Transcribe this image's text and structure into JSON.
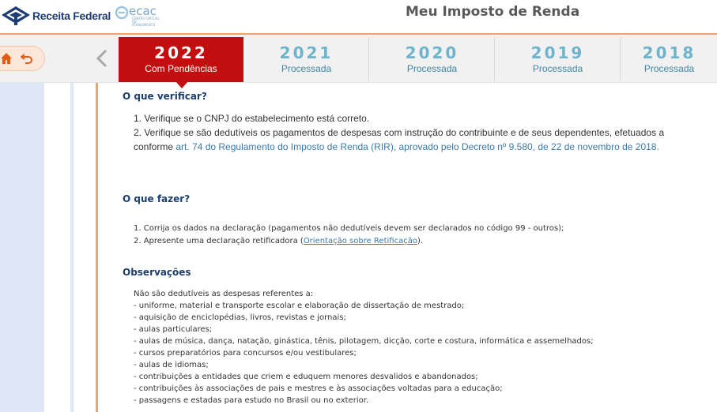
{
  "header": {
    "brand_name": "Receita Federal",
    "ecac_logo_text": "ecac",
    "ecac_subtitle": "CENTRO VIRTUAL DE ATENDIMENTO",
    "app_title": "Meu Imposto de Renda"
  },
  "nav": {
    "home_icon": "home-icon",
    "back_icon": "undo-arrow-icon",
    "prev_icon": "chevron-left-icon"
  },
  "tabs": [
    {
      "year": "2022",
      "status": "Com Pendências",
      "active": true
    },
    {
      "year": "2021",
      "status": "Processada",
      "active": false
    },
    {
      "year": "2020",
      "status": "Processada",
      "active": false
    },
    {
      "year": "2019",
      "status": "Processada",
      "active": false
    },
    {
      "year": "2018",
      "status": "Processada",
      "active": false
    }
  ],
  "verificar": {
    "title": "O que verificar?",
    "item1": "1. Verifique se o CNPJ do estabelecimento está correto.",
    "item2": "2. Verifique se são dedutíveis os pagamentos de despesas com instrução do contribuinte e de seus dependentes, efetuados a",
    "item2_cont_prefix": "conforme ",
    "item2_link": "art. 74 do Regulamento do Imposto de Renda (RIR), aprovado pelo Decreto nº 9.580, de 22 de novembro de 2018."
  },
  "fazer": {
    "title": "O que fazer?",
    "item1": "1. Corrija os dados na declaração (pagamentos não dedutíveis devem ser declarados no código 99 - outros);",
    "item2_prefix": "2. Apresente uma declaração retificadora (",
    "item2_link": "Orientação sobre Retificação",
    "item2_suffix": ")."
  },
  "observacoes": {
    "title": "Observações",
    "intro": "Não são dedutíveis as despesas referentes a:",
    "items": [
      "- uniforme, material e transporte escolar e elaboração de dissertação de mestrado;",
      "- aquisição de enciclopédias, livros, revistas e jornais;",
      "- aulas particulares;",
      "- aulas de música, dança, natação, ginástica, tênis, pilotagem, dicção, corte e costura, informática e assemelhados;",
      "- cursos preparatórios para concursos e/ou vestibulares;",
      "- aulas de idiomas;",
      "- contribuições a entidades que criem e eduquem menores desvalidos e abandonados;",
      "- contribuições às associações de pais e mestres e às associações voltadas para a educação;",
      "- passagens e estadas para estudo no Brasil ou no exterior."
    ]
  },
  "colors": {
    "accent_red": "#c20e0e",
    "accent_orange": "#f0a26a",
    "year_blue": "#6fb3cc",
    "heading_navy": "#1d3e6d",
    "link_blue": "#3b79a8"
  }
}
